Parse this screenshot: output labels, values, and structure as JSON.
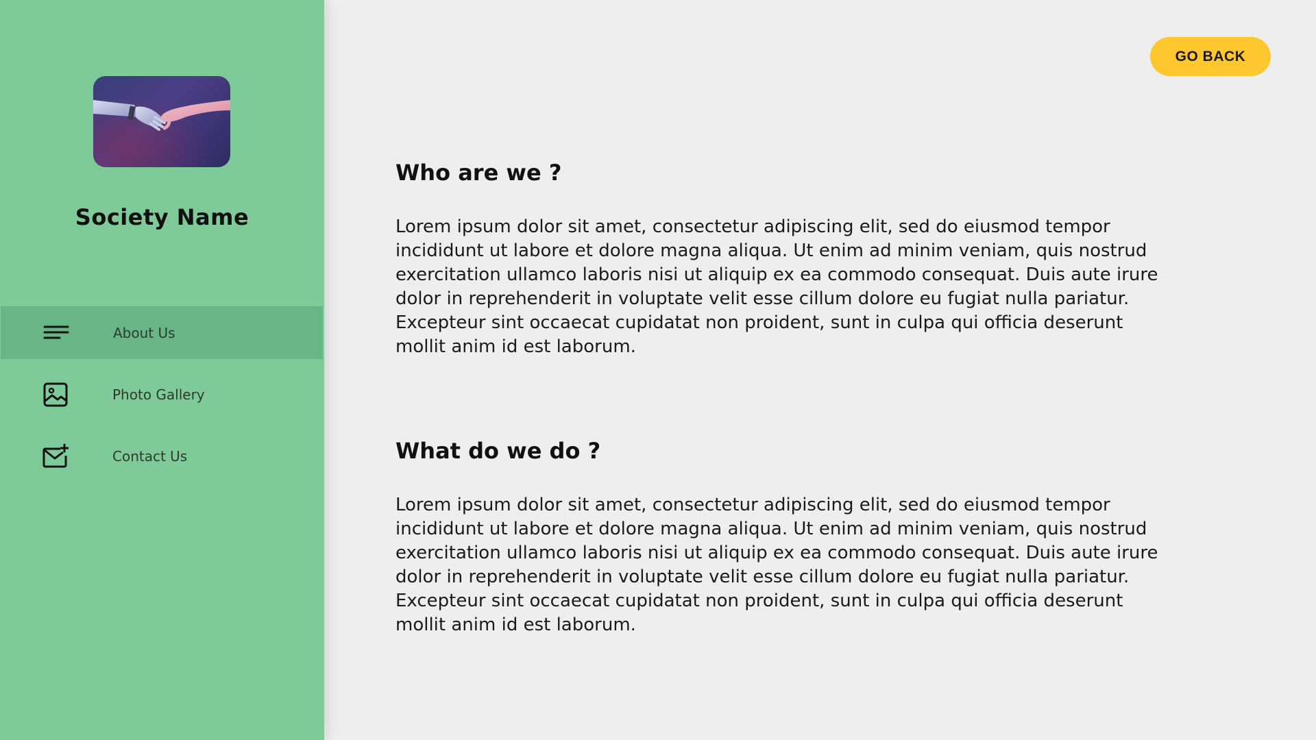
{
  "sidebar": {
    "society_name": "Society Name",
    "logo_alt": "robot-human-handshake-image",
    "items": [
      {
        "label": "About Us",
        "icon": "menu-lines-icon",
        "active": true
      },
      {
        "label": "Photo Gallery",
        "icon": "image-icon",
        "active": false
      },
      {
        "label": "Contact Us",
        "icon": "mail-plus-icon",
        "active": false
      }
    ]
  },
  "header": {
    "go_back_label": "GO BACK"
  },
  "main": {
    "sections": [
      {
        "title": "Who are we ?",
        "text": "Lorem ipsum dolor sit amet, consectetur adipiscing elit, sed do eiusmod tempor incididunt ut labore et dolore magna aliqua. Ut enim ad minim veniam, quis nostrud exercitation ullamco laboris nisi ut aliquip ex ea commodo consequat. Duis aute irure dolor in reprehenderit in voluptate velit esse cillum dolore eu fugiat nulla pariatur. Excepteur sint occaecat cupidatat non proident, sunt in culpa qui officia deserunt mollit anim id est laborum."
      },
      {
        "title": "What do we do ?",
        "text": "Lorem ipsum dolor sit amet, consectetur adipiscing elit, sed do eiusmod tempor incididunt ut labore et dolore magna aliqua. Ut enim ad minim veniam, quis nostrud exercitation ullamco laboris nisi ut aliquip ex ea commodo consequat. Duis aute irure dolor in reprehenderit in voluptate velit esse cillum dolore eu fugiat nulla pariatur. Excepteur sint occaecat cupidatat non proident, sunt in culpa qui officia deserunt mollit anim id est laborum."
      }
    ]
  },
  "colors": {
    "sidebar_bg": "#7fca99",
    "sidebar_active": "#68b585",
    "main_bg": "#eeeeee",
    "button_accent": "#fec72e"
  }
}
